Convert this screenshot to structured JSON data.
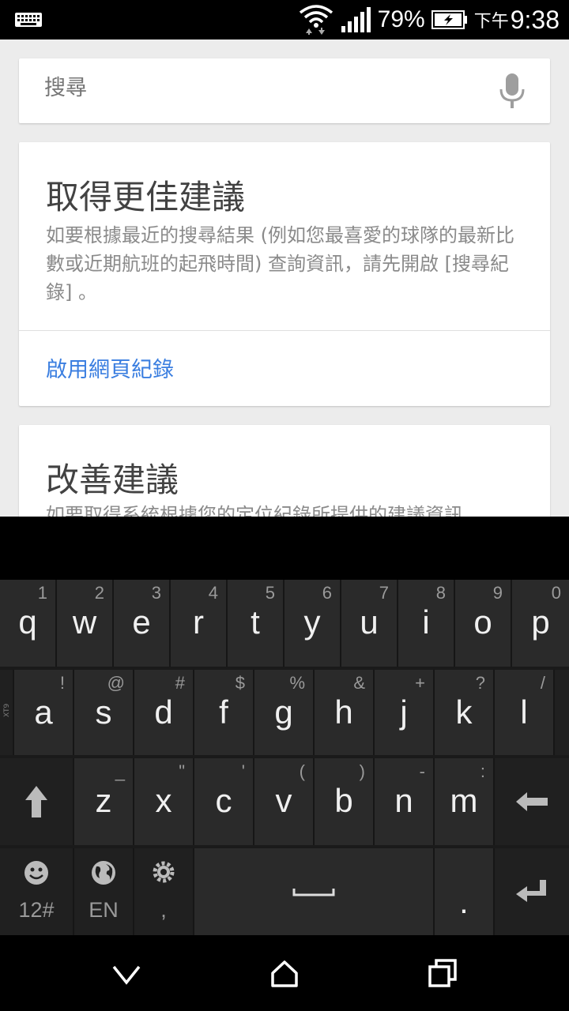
{
  "status_bar": {
    "battery_percent": "79%",
    "am_pm": "下午",
    "time": "9:38",
    "icons": [
      "keyboard-icon",
      "wifi-icon",
      "signal-icon",
      "battery-charging-icon"
    ]
  },
  "search": {
    "placeholder": "搜尋",
    "mic_icon": "mic-icon"
  },
  "cards": [
    {
      "title": "取得更佳建議",
      "body": "如要根據最近的搜尋結果 (例如您最喜愛的球隊的最新比數或近期航班的起飛時間) 查詢資訊，請先開啟 [搜尋紀錄] 。",
      "action": "啟用網頁紀錄"
    },
    {
      "title": "改善建議",
      "body": "如要取得系統根據您的定位紀錄所提供的建議資訊"
    }
  ],
  "keyboard": {
    "side_label": "XT9",
    "row1": [
      {
        "key": "q",
        "hint": "1"
      },
      {
        "key": "w",
        "hint": "2"
      },
      {
        "key": "e",
        "hint": "3"
      },
      {
        "key": "r",
        "hint": "4"
      },
      {
        "key": "t",
        "hint": "5"
      },
      {
        "key": "y",
        "hint": "6"
      },
      {
        "key": "u",
        "hint": "7"
      },
      {
        "key": "i",
        "hint": "8"
      },
      {
        "key": "o",
        "hint": "9"
      },
      {
        "key": "p",
        "hint": "0"
      }
    ],
    "row2": [
      {
        "key": "a",
        "hint": "!"
      },
      {
        "key": "s",
        "hint": "@"
      },
      {
        "key": "d",
        "hint": "#"
      },
      {
        "key": "f",
        "hint": "$"
      },
      {
        "key": "g",
        "hint": "%"
      },
      {
        "key": "h",
        "hint": "&"
      },
      {
        "key": "j",
        "hint": "+"
      },
      {
        "key": "k",
        "hint": "?"
      },
      {
        "key": "l",
        "hint": "/"
      }
    ],
    "row3": [
      {
        "key": "z",
        "hint": "_"
      },
      {
        "key": "x",
        "hint": "\""
      },
      {
        "key": "c",
        "hint": "'"
      },
      {
        "key": "v",
        "hint": "("
      },
      {
        "key": "b",
        "hint": ")"
      },
      {
        "key": "n",
        "hint": "-"
      },
      {
        "key": "m",
        "hint": ":"
      }
    ],
    "row4": {
      "numbers_label": "12#",
      "lang_label": "EN",
      "comma_label": ",",
      "period_label": "."
    }
  },
  "colors": {
    "link": "#3a7ee0",
    "key_bg": "#2a2a2a",
    "app_bg": "#ececec"
  }
}
